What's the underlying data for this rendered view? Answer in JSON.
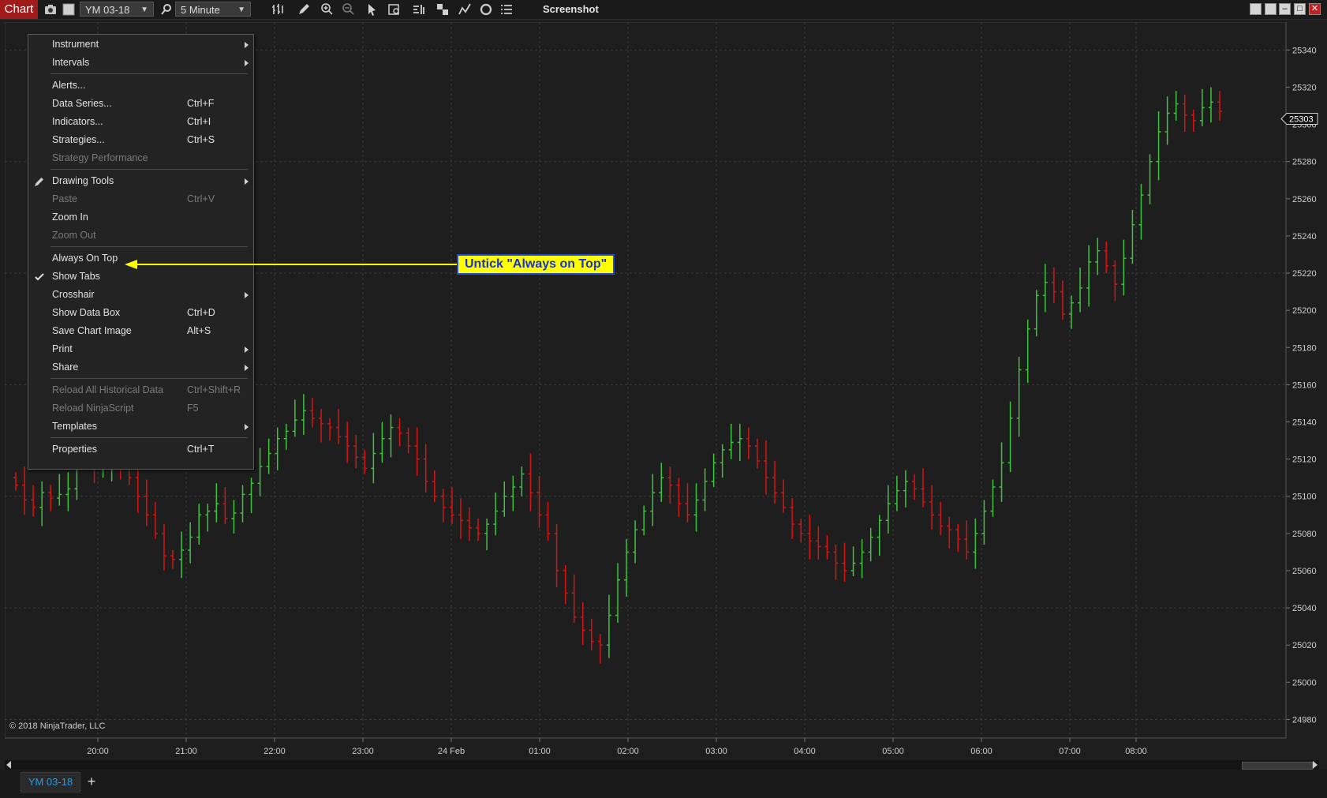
{
  "toolbar": {
    "chart_label": "Chart",
    "instrument": "YM 03-18",
    "interval": "5 Minute",
    "screenshot_label": "Screenshot"
  },
  "menu": {
    "items": [
      {
        "label": "Instrument",
        "shortcut": "",
        "submenu": true,
        "disabled": false,
        "icon": ""
      },
      {
        "label": "Intervals",
        "shortcut": "",
        "submenu": true,
        "disabled": false,
        "icon": ""
      },
      {
        "label": "Alerts...",
        "shortcut": "",
        "submenu": false,
        "disabled": false,
        "icon": ""
      },
      {
        "label": "Data Series...",
        "shortcut": "Ctrl+F",
        "submenu": false,
        "disabled": false,
        "icon": ""
      },
      {
        "label": "Indicators...",
        "shortcut": "Ctrl+I",
        "submenu": false,
        "disabled": false,
        "icon": ""
      },
      {
        "label": "Strategies...",
        "shortcut": "Ctrl+S",
        "submenu": false,
        "disabled": false,
        "icon": ""
      },
      {
        "label": "Strategy Performance",
        "shortcut": "",
        "submenu": false,
        "disabled": true,
        "icon": ""
      },
      {
        "label": "Drawing Tools",
        "shortcut": "",
        "submenu": true,
        "disabled": false,
        "icon": "pencil-icon"
      },
      {
        "label": "Paste",
        "shortcut": "Ctrl+V",
        "submenu": false,
        "disabled": true,
        "icon": ""
      },
      {
        "label": "Zoom In",
        "shortcut": "",
        "submenu": false,
        "disabled": false,
        "icon": ""
      },
      {
        "label": "Zoom Out",
        "shortcut": "",
        "submenu": false,
        "disabled": true,
        "icon": ""
      },
      {
        "label": "Always On Top",
        "shortcut": "",
        "submenu": false,
        "disabled": false,
        "icon": ""
      },
      {
        "label": "Show Tabs",
        "shortcut": "",
        "submenu": false,
        "disabled": false,
        "icon": "check-icon"
      },
      {
        "label": "Crosshair",
        "shortcut": "",
        "submenu": true,
        "disabled": false,
        "icon": ""
      },
      {
        "label": "Show Data Box",
        "shortcut": "Ctrl+D",
        "submenu": false,
        "disabled": false,
        "icon": ""
      },
      {
        "label": "Save Chart Image",
        "shortcut": "Alt+S",
        "submenu": false,
        "disabled": false,
        "icon": ""
      },
      {
        "label": "Print",
        "shortcut": "",
        "submenu": true,
        "disabled": false,
        "icon": ""
      },
      {
        "label": "Share",
        "shortcut": "",
        "submenu": true,
        "disabled": false,
        "icon": ""
      },
      {
        "label": "Reload All Historical Data",
        "shortcut": "Ctrl+Shift+R",
        "submenu": false,
        "disabled": true,
        "icon": ""
      },
      {
        "label": "Reload NinjaScript",
        "shortcut": "F5",
        "submenu": false,
        "disabled": true,
        "icon": ""
      },
      {
        "label": "Templates",
        "shortcut": "",
        "submenu": true,
        "disabled": false,
        "icon": ""
      },
      {
        "label": "Properties",
        "shortcut": "Ctrl+T",
        "submenu": false,
        "disabled": false,
        "icon": ""
      }
    ]
  },
  "annotation": "Untick \"Always on Top\"",
  "copyright": "© 2018 NinjaTrader, LLC",
  "tabs": {
    "active": "YM 03-18",
    "add": "+"
  },
  "colors": {
    "up": "#3ec43e",
    "down": "#d61414",
    "accent": "#a11b1b",
    "callout_bg": "#ffff00",
    "callout_text": "#1a33c8",
    "tab_text": "#2c9bdf"
  },
  "chart_data": {
    "type": "ohlc",
    "instrument": "YM 03-18",
    "interval": "5 Minute",
    "ylim": [
      24970,
      25355
    ],
    "y_ticks": [
      24980,
      25000,
      25020,
      25040,
      25060,
      25080,
      25100,
      25120,
      25140,
      25160,
      25180,
      25200,
      25220,
      25240,
      25260,
      25280,
      25300,
      25320,
      25340
    ],
    "x_ticks": [
      "20:00",
      "21:00",
      "22:00",
      "23:00",
      "24 Feb",
      "01:00",
      "02:00",
      "03:00",
      "04:00",
      "05:00",
      "06:00",
      "07:00",
      "08:00"
    ],
    "last_price": 25303,
    "closes": [
      25106,
      25098,
      25094,
      25102,
      25099,
      25101,
      25104,
      25120,
      25122,
      25115,
      25118,
      25122,
      25116,
      25110,
      25100,
      25090,
      25080,
      25068,
      25066,
      25071,
      25078,
      25090,
      25092,
      25096,
      25088,
      25091,
      25101,
      25107,
      25116,
      25123,
      25131,
      25135,
      25141,
      25146,
      25142,
      25139,
      25137,
      25132,
      25127,
      25121,
      25115,
      25123,
      25131,
      25137,
      25134,
      25127,
      25120,
      25108,
      25100,
      25094,
      25090,
      25087,
      25083,
      25080,
      25085,
      25092,
      25100,
      25105,
      25112,
      25102,
      25090,
      25080,
      25060,
      25048,
      25035,
      25028,
      25022,
      25020,
      25036,
      25055,
      25070,
      25082,
      25092,
      25102,
      25110,
      25106,
      25096,
      25090,
      25098,
      25108,
      25118,
      25125,
      25129,
      25131,
      25127,
      25119,
      25110,
      25102,
      25094,
      25085,
      25080,
      25076,
      25073,
      25070,
      25064,
      25060,
      25064,
      25070,
      25078,
      25087,
      25096,
      25103,
      25108,
      25104,
      25097,
      25090,
      25084,
      25082,
      25077,
      25070,
      25080,
      25092,
      25105,
      25118,
      25142,
      25168,
      25190,
      25208,
      25215,
      25210,
      25198,
      25204,
      25212,
      25226,
      25232,
      25224,
      25214,
      25228,
      25246,
      25262,
      25280,
      25296,
      25306,
      25311,
      25305,
      25302,
      25309,
      25312,
      25307
    ]
  }
}
